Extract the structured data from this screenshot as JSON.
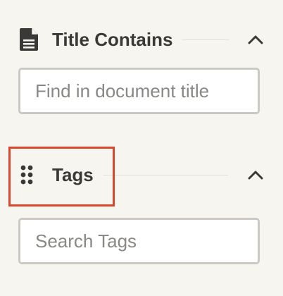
{
  "filters": {
    "title_section": {
      "title": "Title Contains",
      "icon": "document-icon",
      "toggle_icon": "chevron-up-icon",
      "input_placeholder": "Find in document title",
      "input_value": ""
    },
    "tags_section": {
      "title": "Tags",
      "icon": "drag-handle-icon",
      "toggle_icon": "chevron-up-icon",
      "input_placeholder": "Search Tags",
      "input_value": ""
    }
  },
  "colors": {
    "background": "#f6f5f0",
    "text": "#3b3937",
    "border": "#cbc9c3",
    "highlight": "#d9462b"
  }
}
